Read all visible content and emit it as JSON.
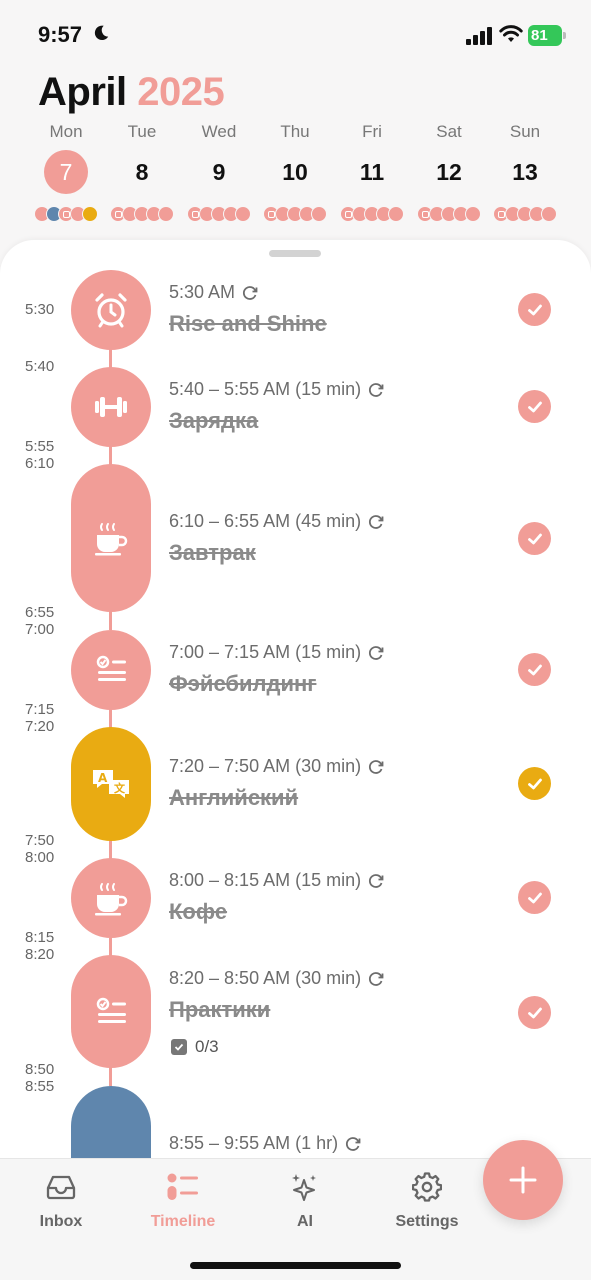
{
  "status": {
    "time": "9:57",
    "battery": "81"
  },
  "header": {
    "month": "April",
    "year": "2025"
  },
  "week": [
    {
      "name": "Mon",
      "num": "7",
      "selected": true
    },
    {
      "name": "Tue",
      "num": "8"
    },
    {
      "name": "Wed",
      "num": "9"
    },
    {
      "name": "Thu",
      "num": "10"
    },
    {
      "name": "Fri",
      "num": "11"
    },
    {
      "name": "Sat",
      "num": "12"
    },
    {
      "name": "Sun",
      "num": "13"
    }
  ],
  "timeline": {
    "time_labels": [
      "5:30",
      "5:40",
      "5:55",
      "6:10",
      "6:55",
      "7:00",
      "7:15",
      "7:20",
      "7:50",
      "8:00",
      "8:15",
      "8:20",
      "8:50",
      "8:55"
    ],
    "events": [
      {
        "time": "5:30 AM",
        "title": "Rise and Shine",
        "icon": "alarm-clock-icon",
        "color": "#f19d97",
        "done": true
      },
      {
        "time": "5:40 – 5:55 AM (15 min)",
        "title": "Зарядка",
        "icon": "dumbbell-icon",
        "color": "#f19d97",
        "done": true
      },
      {
        "time": "6:10 – 6:55 AM (45 min)",
        "title": "Завтрак",
        "icon": "coffee-cup-icon",
        "color": "#f19d97",
        "done": true
      },
      {
        "time": "7:00 – 7:15 AM (15 min)",
        "title": "Фэйсбилдинг",
        "icon": "checklist-icon",
        "color": "#f19d97",
        "done": true
      },
      {
        "time": "7:20 – 7:50 AM (30 min)",
        "title": "Английский",
        "icon": "translate-icon",
        "color": "#e9ab12",
        "done": true
      },
      {
        "time": "8:00 – 8:15 AM (15 min)",
        "title": "Кофе",
        "icon": "coffee-cup-icon",
        "color": "#f19d97",
        "done": true
      },
      {
        "time": "8:20 – 8:50 AM (30 min)",
        "title": "Практики",
        "icon": "checklist-icon",
        "color": "#f19d97",
        "done": true,
        "subtasks": "0/3"
      },
      {
        "time": "8:55 – 9:55 AM (1 hr)",
        "title": "",
        "icon": "",
        "color": "#5f86ad",
        "done": false
      }
    ]
  },
  "tabs": [
    {
      "label": "Inbox",
      "icon": "inbox-tray-icon"
    },
    {
      "label": "Timeline",
      "icon": "timeline-list-icon",
      "active": true
    },
    {
      "label": "AI",
      "icon": "sparkles-icon"
    },
    {
      "label": "Settings",
      "icon": "gear-icon"
    }
  ],
  "colors": {
    "accent": "#f19d97",
    "yellow": "#e9ab12",
    "blue": "#5f86ad"
  }
}
